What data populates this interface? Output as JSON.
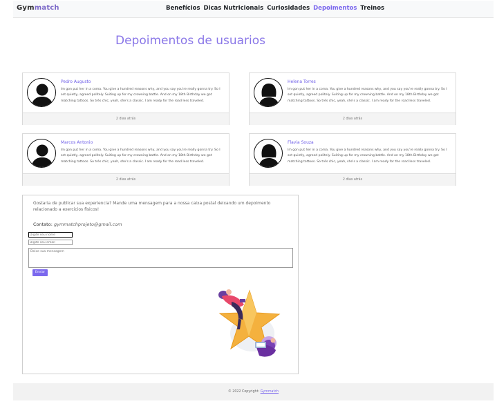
{
  "navbar": {
    "brand_part1": "Gym",
    "brand_part2": "match",
    "links": [
      "Benefícios",
      "Dicas Nutricionais",
      "Curiosidades",
      "Depoimentos",
      "Treinos"
    ],
    "active_index": 3
  },
  "page_title": "Depoimentos de usuarios",
  "testimonials": [
    {
      "name": "Pedro Augusto",
      "text": "Im gon put her in a coma. You give a hundred reasons why, and you say you're really gonna try. So I set quietly, agreed politely. Suiting up for my crowning battle. And on my 18th Birthday we got matching tattoos. So trés chic, yeah, she's a classic. I am ready for the road less traveled.",
      "time": "2 dias atrás"
    },
    {
      "name": "Helena Torres",
      "text": "Im gon put her in a coma. You give a hundred reasons why, and you say you're really gonna try. So I set quietly, agreed politely. Suiting up for my crowning battle. And on my 18th Birthday we got matching tattoos. So trés chic, yeah, she's a classic. I am ready for the road less traveled.",
      "time": "2 dias atrás"
    },
    {
      "name": "Marcos Antonio",
      "text": "Im gon put her in a coma. You give a hundred reasons why, and you say you're really gonna try. So I set quietly, agreed politely. Suiting up for my crowning battle. And on my 18th Birthday we got matching tattoos. So trés chic, yeah, she's a classic. I am ready for the road less traveled.",
      "time": "2 dias atrás"
    },
    {
      "name": "Flavia Souza",
      "text": "Im gon put her in a coma. You give a hundred reasons why, and you say you're really gonna try. So I set quietly, agreed politely. Suiting up for my crowning battle. And on my 18th Birthday we got matching tattoos. So trés chic, yeah, she's a classic. I am ready for the road less traveled.",
      "time": "2 dias atrás"
    }
  ],
  "form": {
    "intro": "Gostaria de publicar sua experiencia? Mande uma mensagem para a nossa caixa postal deixando um depoimento relacionado a exercicios fisicos!",
    "contact_label": "Contato:",
    "contact_email": "gymmatchprojeto@gmail.com",
    "name_placeholder": "Digite seu nome",
    "email_placeholder": "Digite seu email",
    "message_placeholder": "Deixe sua mensagem",
    "submit_label": "Enviar"
  },
  "footer": {
    "text": "© 2022 Copyright: ",
    "brand": "Gymmatch"
  },
  "colors": {
    "accent": "#7b68ee",
    "title": "#8a77e8",
    "star": "#f4b13e",
    "illustration_purple": "#6a3fa0"
  }
}
